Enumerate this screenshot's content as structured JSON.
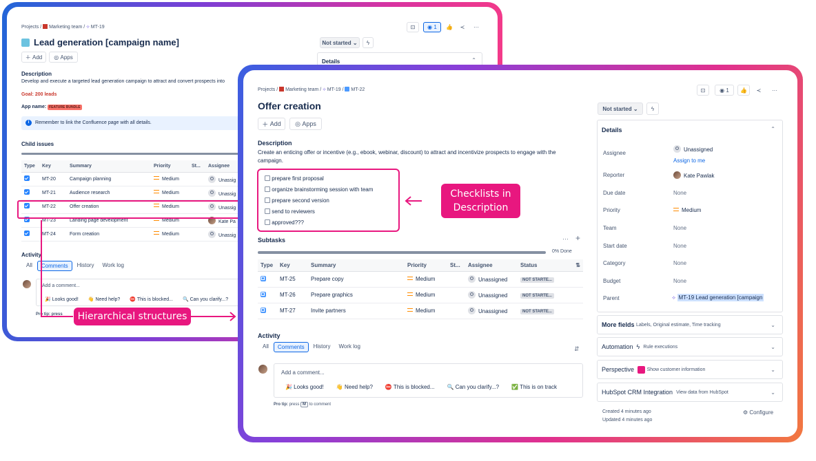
{
  "back": {
    "breadcrumb": {
      "projects": "Projects",
      "team": "Marketing team",
      "issue": "MT-19"
    },
    "title": "Lead generation [campaign name]",
    "add": "Add",
    "apps": "Apps",
    "status": "Not started",
    "watch_count": "1",
    "details_label": "Details",
    "description_heading": "Description",
    "description": "Develop and execute a targeted lead generation campaign to attract and convert prospects into",
    "goal": "Goal: 200 leads",
    "app_name_label": "App name:",
    "app_name_badge": "FEATURE BUNDLE",
    "info": "Remember to link the Confluence page with all details.",
    "child_issues": "Child issues",
    "columns": {
      "type": "Type",
      "key": "Key",
      "summary": "Summary",
      "priority": "Priority",
      "status": "St...",
      "assignee": "Assignee"
    },
    "rows": [
      {
        "key": "MT-20",
        "summary": "Campaign planning",
        "priority": "Medium",
        "assignee": "Unassig"
      },
      {
        "key": "MT-21",
        "summary": "Audience research",
        "priority": "Medium",
        "assignee": "Unassig"
      },
      {
        "key": "MT-22",
        "summary": "Offer creation",
        "priority": "Medium",
        "assignee": "Unassig"
      },
      {
        "key": "MT-23",
        "summary": "Landing page development",
        "priority": "Medium",
        "assignee": "Kate Pa"
      },
      {
        "key": "MT-24",
        "summary": "Form creation",
        "priority": "Medium",
        "assignee": "Unassig"
      }
    ],
    "activity": "Activity",
    "tabs": [
      "All",
      "Comments",
      "History",
      "Work log"
    ],
    "comment_placeholder": "Add a comment...",
    "quick": [
      "🎉 Looks good!",
      "👋 Need help?",
      "⛔ This is blocked...",
      "🔍 Can you clarify...?"
    ],
    "protip": "Pro tip: press"
  },
  "front": {
    "breadcrumb": {
      "projects": "Projects",
      "team": "Marketing team",
      "parent": "MT-19",
      "issue": "MT-22"
    },
    "title": "Offer creation",
    "add": "Add",
    "apps": "Apps",
    "watch_count": "1",
    "description_heading": "Description",
    "description": "Create an enticing offer or incentive (e.g., ebook, webinar, discount) to attract and incentivize prospects to engage with the campaign.",
    "checklist": [
      "prepare first proposal",
      "organize brainstorming session with team",
      "prepare second version",
      "send to reviewers",
      "approved???"
    ],
    "subtasks": "Subtasks",
    "progress": "0% Done",
    "progress_value": 0,
    "columns": {
      "type": "Type",
      "key": "Key",
      "summary": "Summary",
      "priority": "Priority",
      "status": "St...",
      "assignee": "Assignee",
      "status2": "Status"
    },
    "rows": [
      {
        "key": "MT-25",
        "summary": "Prepare copy",
        "priority": "Medium",
        "assignee": "Unassigned",
        "status": "NOT STARTE..."
      },
      {
        "key": "MT-26",
        "summary": "Prepare graphics",
        "priority": "Medium",
        "assignee": "Unassigned",
        "status": "NOT STARTE..."
      },
      {
        "key": "MT-27",
        "summary": "Invite partners",
        "priority": "Medium",
        "assignee": "Unassigned",
        "status": "NOT STARTE..."
      }
    ],
    "activity": "Activity",
    "tabs": [
      "All",
      "Comments",
      "History",
      "Work log"
    ],
    "comment_placeholder": "Add a comment...",
    "quick": [
      "🎉 Looks good!",
      "👋 Need help?",
      "⛔ This is blocked...",
      "🔍 Can you clarify...?",
      "✅ This is on track"
    ],
    "protip_pre": "Pro tip:",
    "protip_press": "press",
    "protip_key": "M",
    "protip_post": "to comment",
    "status": "Not started",
    "details": {
      "heading": "Details",
      "assignee_label": "Assignee",
      "assignee": "Unassigned",
      "assign_me": "Assign to me",
      "reporter_label": "Reporter",
      "reporter": "Kate Pawlak",
      "due_label": "Due date",
      "due": "None",
      "priority_label": "Priority",
      "priority": "Medium",
      "team_label": "Team",
      "team": "None",
      "start_label": "Start date",
      "start": "None",
      "category_label": "Category",
      "category": "None",
      "budget_label": "Budget",
      "budget": "None",
      "parent_label": "Parent",
      "parent": "MT-19 Lead generation [campaign"
    },
    "more_fields": {
      "label": "More fields",
      "sub": "Labels, Original estimate, Time tracking"
    },
    "automation": {
      "label": "Automation",
      "sub": "Rule executions"
    },
    "perspective": {
      "label": "Perspective",
      "sub": "Show customer information"
    },
    "hubspot": {
      "label": "HubSpot CRM Integration",
      "sub": "View data from HubSpot"
    },
    "created": "Created 4 minutes ago",
    "updated": "Updated 4 minutes ago",
    "configure": "Configure"
  },
  "callouts": {
    "checklists": "Checklists in Description",
    "hierarchy": "Hierarchical structures"
  },
  "colors": {
    "accent": "#e8177f",
    "link": "#0c66e4",
    "goal": "#c9372c"
  }
}
